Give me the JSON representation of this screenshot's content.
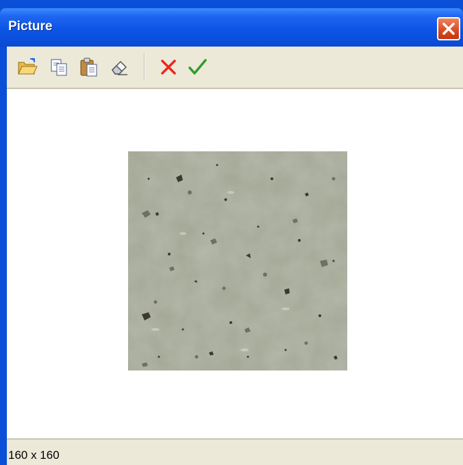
{
  "window": {
    "title": "Picture"
  },
  "toolbar": {
    "buttons": [
      {
        "name": "open-icon"
      },
      {
        "name": "copy-icon"
      },
      {
        "name": "paste-icon"
      },
      {
        "name": "eraser-icon"
      },
      {
        "name": "cancel-icon",
        "color": "#e8291c"
      },
      {
        "name": "ok-icon",
        "color": "#2e9e2a"
      }
    ]
  },
  "image": {
    "texture": "speckled gray-green stone"
  },
  "status": {
    "text": "160 x 160"
  },
  "colors": {
    "titlebar": "#0c55e6",
    "chrome": "#ece9d8",
    "close": "#d84a20"
  }
}
